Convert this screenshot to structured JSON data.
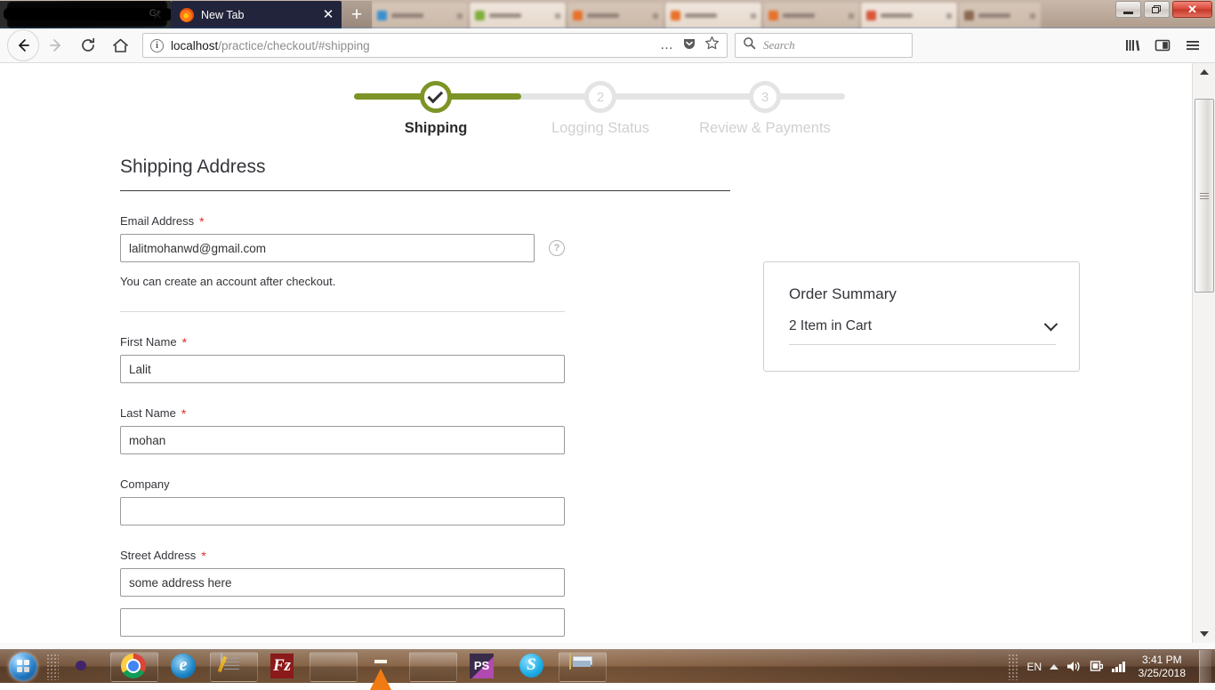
{
  "window": {
    "controls": {
      "minimize": "–",
      "restore": "❐",
      "close": "✕"
    }
  },
  "browser": {
    "tabs": [
      {
        "title": "",
        "redacted": true,
        "ghost_text": "Gr",
        "close": "✕",
        "active": false
      },
      {
        "title": "New Tab",
        "redacted": false,
        "close": "✕",
        "active": true
      }
    ],
    "new_tab_label": "+",
    "nav": {
      "back": "←",
      "forward": "→",
      "reload": "⟳",
      "home": "⌂"
    },
    "address": {
      "host": "localhost",
      "path": "/practice/checkout/#shipping",
      "full": "localhost/practice/checkout/#shipping",
      "info_icon": "i",
      "page_actions": "…",
      "pocket_icon": "pocket-icon",
      "bookmark_icon": "star-icon"
    },
    "search": {
      "placeholder": "Search",
      "icon": "search-icon"
    },
    "toolbar_right": {
      "library": "library-icon",
      "sidebar": "sidebar-icon",
      "menu": "hamburger-menu-icon"
    }
  },
  "page": {
    "stepper": {
      "steps": [
        {
          "index": "1",
          "label": "Shipping",
          "state": "complete",
          "marker": "check"
        },
        {
          "index": "2",
          "label": "Logging Status",
          "state": "pending",
          "marker": "2"
        },
        {
          "index": "3",
          "label": "Review & Payments",
          "state": "pending",
          "marker": "3"
        }
      ],
      "accent_color": "#7d9426",
      "track_color": "#e4e4e4"
    },
    "heading": "Shipping Address",
    "fields": [
      {
        "name": "email",
        "label": "Email Address",
        "required": "*",
        "value": "lalitmohanwd@gmail.com",
        "hint": "You can create an account after checkout.",
        "tooltip_icon": "?"
      },
      {
        "name": "first-name",
        "label": "First Name",
        "required": "*",
        "value": "Lalit"
      },
      {
        "name": "last-name",
        "label": "Last Name",
        "required": "*",
        "value": "mohan"
      },
      {
        "name": "company",
        "label": "Company",
        "required": "",
        "value": ""
      },
      {
        "name": "street-address-1",
        "label": "Street Address",
        "required": "*",
        "value": "some address here"
      },
      {
        "name": "street-address-2",
        "label": "",
        "required": "",
        "value": ""
      }
    ],
    "order_summary": {
      "title": "Order Summary",
      "cart_text": "2 Item in Cart",
      "toggle_icon": "chevron-down-icon"
    }
  },
  "taskbar": {
    "start": "start-orb",
    "items": [
      {
        "name": "unknown-purple-app",
        "label": ""
      },
      {
        "name": "google-chrome",
        "label": ""
      },
      {
        "name": "internet-explorer",
        "label": ""
      },
      {
        "name": "notepad-editor",
        "label": ""
      },
      {
        "name": "filezilla",
        "label": "Fz"
      },
      {
        "name": "sourcetree",
        "label": ""
      },
      {
        "name": "vlc-media-player",
        "label": ""
      },
      {
        "name": "mozilla-firefox",
        "label": ""
      },
      {
        "name": "phpstorm",
        "label": "PS"
      },
      {
        "name": "skype",
        "label": "S"
      },
      {
        "name": "file-explorer",
        "label": ""
      }
    ],
    "tray": {
      "language": "EN",
      "show_hidden_icon": "chevron-up-icon",
      "volume_icon": "speaker-icon",
      "network_icon": "network-icon",
      "signal_icon": "signal-bars-icon",
      "time": "3:41 PM",
      "date": "3/25/2018"
    }
  }
}
